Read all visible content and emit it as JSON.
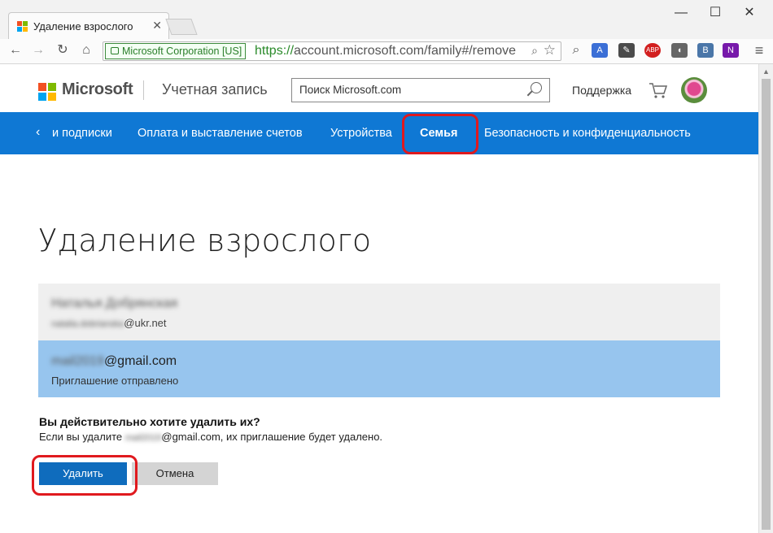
{
  "browser": {
    "tab_title": "Удаление взрослого",
    "ev_label": "Microsoft Corporation [US]",
    "url_scheme": "https://",
    "url_rest": "account.microsoft.com/family#/remove",
    "extensions": [
      {
        "name": "translate-extension-icon",
        "color": "#3b6fd6",
        "glyph": "A"
      },
      {
        "name": "evernote-extension-icon",
        "color": "#4a4a4a",
        "glyph": "✎"
      },
      {
        "name": "adblock-extension-icon",
        "color": "#d21f1f",
        "glyph": "ABP"
      },
      {
        "name": "audio-extension-icon",
        "color": "#666666",
        "glyph": "◖"
      },
      {
        "name": "vk-extension-icon",
        "color": "#4a76a8",
        "glyph": "В"
      },
      {
        "name": "onenote-extension-icon",
        "color": "#7719aa",
        "glyph": "N"
      }
    ]
  },
  "header": {
    "brand": "Microsoft",
    "section": "Учетная запись",
    "search_placeholder": "Поиск Microsoft.com",
    "support": "Поддержка"
  },
  "nav": {
    "back_glyph": "‹",
    "items": [
      {
        "label": "и подписки"
      },
      {
        "label": "Оплата и выставление счетов"
      },
      {
        "label": "Устройства"
      },
      {
        "label": "Семья"
      },
      {
        "label": "Безопасность и конфиденциальность"
      }
    ]
  },
  "main": {
    "title": "Удаление взрослого",
    "member1": {
      "name": "Наталья Добрянская",
      "email_hidden": "natalia.dobrianska",
      "email_domain": "@ukr.net"
    },
    "member2": {
      "email_hidden": "mail2019",
      "email_domain": "@gmail.com",
      "status": "Приглашение отправлено"
    },
    "confirm_question": "Вы действительно хотите удалить их?",
    "confirm_text_before": "Если вы удалите ",
    "confirm_hidden": "mail2019",
    "confirm_text_after": "@gmail.com, их приглашение будет удалено.",
    "delete_label": "Удалить",
    "cancel_label": "Отмена"
  },
  "colors": {
    "nav_bg": "#0f78d4",
    "delete_button": "#0f6cbd",
    "selected_row": "#97c5ee",
    "highlight_outline": "#e0191e"
  }
}
